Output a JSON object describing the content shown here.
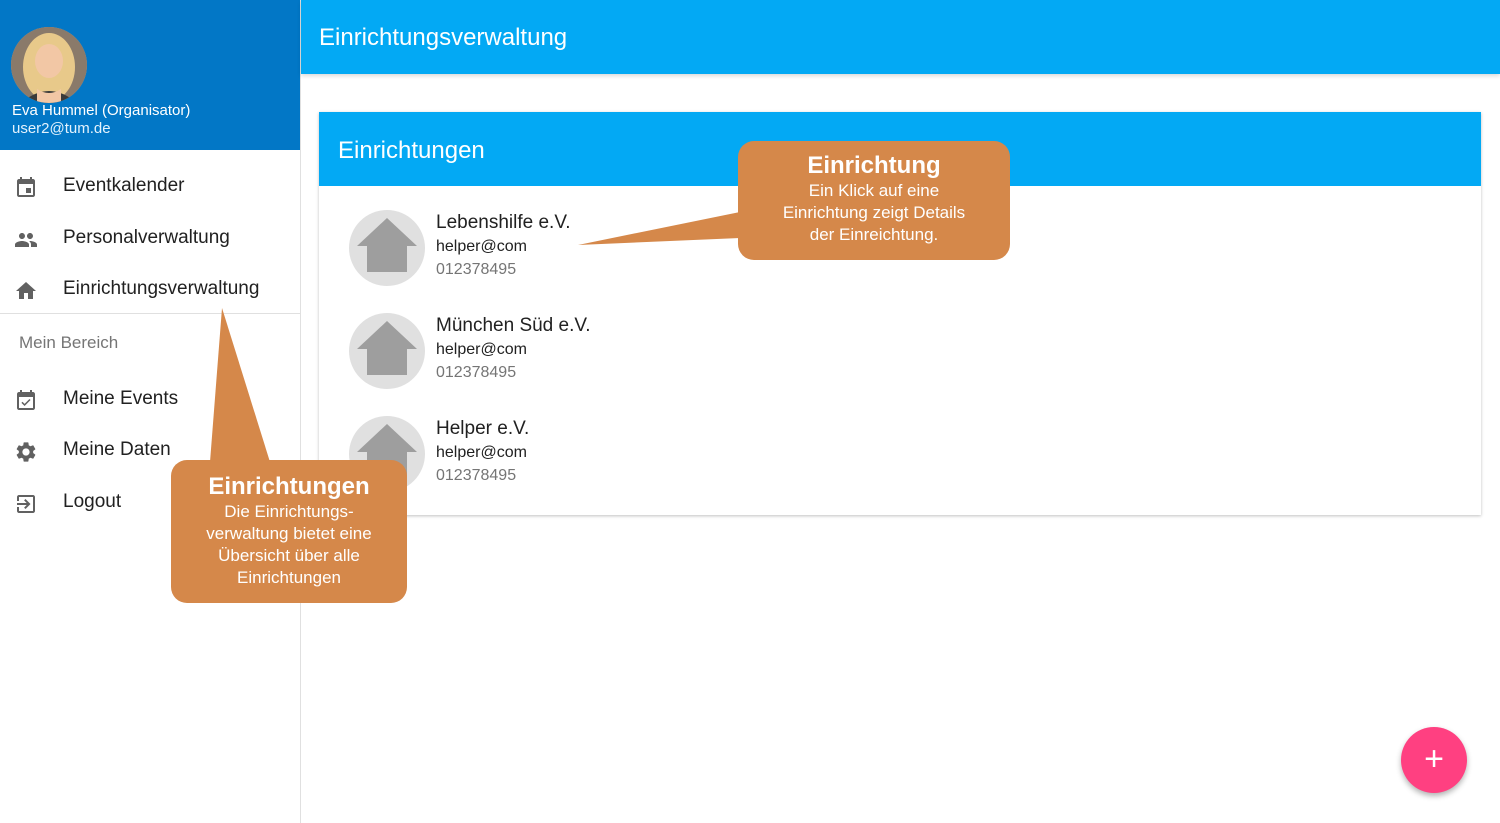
{
  "user": {
    "name": "Eva Hummel (Organisator)",
    "email": "user2@tum.de"
  },
  "nav": {
    "items": [
      {
        "label": "Eventkalender",
        "icon": "calendar-icon"
      },
      {
        "label": "Personalverwaltung",
        "icon": "people-icon"
      },
      {
        "label": "Einrichtungsverwaltung",
        "icon": "home-icon"
      }
    ],
    "subheader": "Mein Bereich",
    "personal_items": [
      {
        "label": "Meine Events",
        "icon": "calendar-check-icon"
      },
      {
        "label": "Meine Daten",
        "icon": "gear-icon"
      },
      {
        "label": "Logout",
        "icon": "logout-icon"
      }
    ]
  },
  "appbar": {
    "title": "Einrichtungsverwaltung"
  },
  "card": {
    "title": "Einrichtungen",
    "items": [
      {
        "name": "Lebenshilfe e.V.",
        "email": "helper@com",
        "phone": "012378495"
      },
      {
        "name": "München Süd e.V.",
        "email": "helper@com",
        "phone": "012378495"
      },
      {
        "name": "Helper e.V.",
        "email": "helper@com",
        "phone": "012378495"
      }
    ]
  },
  "fab": {
    "label": "+"
  },
  "callouts": {
    "einrichtung": {
      "title": "Einrichtung",
      "lines": [
        "Ein Klick auf eine",
        "Einrichtung zeigt Details",
        "der Einreichtung."
      ]
    },
    "einrichtungen": {
      "title": "Einrichtungen",
      "lines": [
        "Die Einrichtungs-",
        "verwaltung bietet eine",
        "Übersicht über alle",
        "Einrichtungen"
      ]
    }
  },
  "colors": {
    "primary_dark": "#0277c6",
    "primary": "#03a9f4",
    "accent": "#ff4081",
    "callout": "#d5884a"
  }
}
